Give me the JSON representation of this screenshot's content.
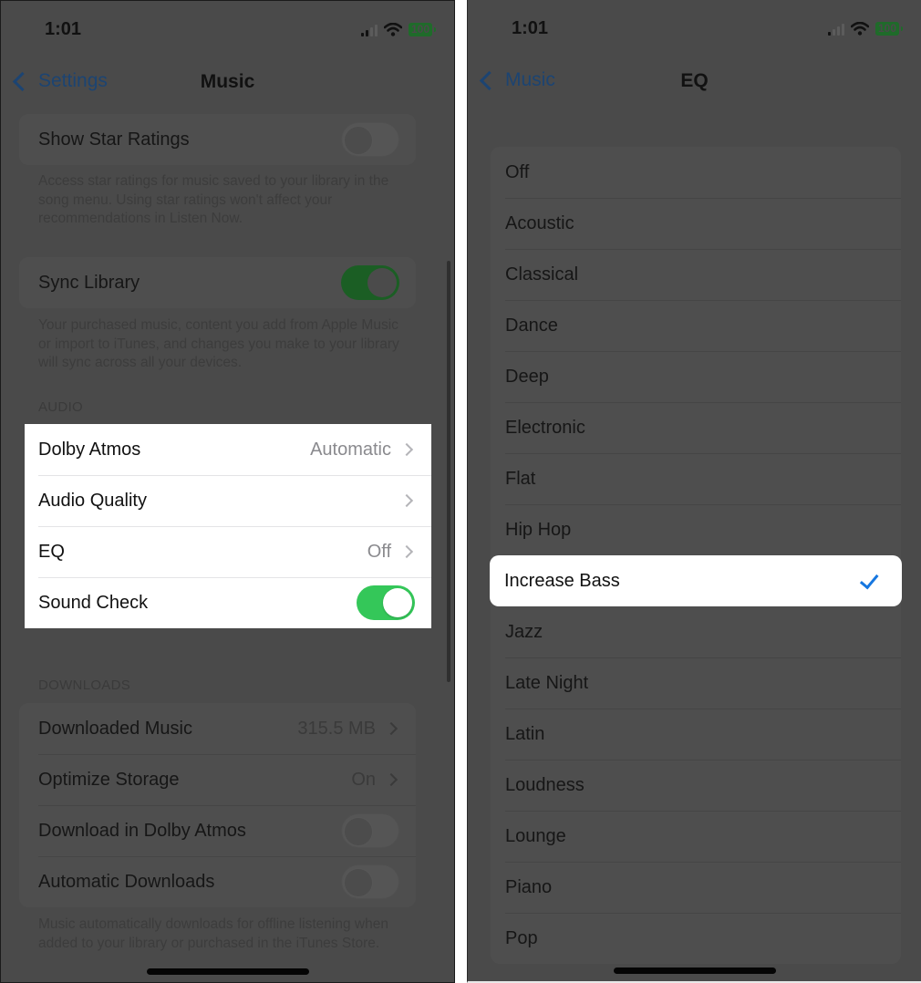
{
  "left_screen": {
    "status_bar": {
      "time": "1:01",
      "battery": "100",
      "icons": [
        "cellular-signal-icon",
        "wifi-icon",
        "battery-icon"
      ]
    },
    "nav": {
      "back_label": "Settings",
      "title": "Music"
    },
    "library_group_1": {
      "rows": [
        {
          "label": "Show Star Ratings",
          "toggle": "off"
        }
      ],
      "footer": "Access star ratings for music saved to your library in the song menu. Using star ratings won't affect your recommendations in Listen Now."
    },
    "library_group_2": {
      "rows": [
        {
          "label": "Sync Library",
          "toggle": "on"
        }
      ],
      "footer": "Your purchased music, content you add from Apple Music or import to iTunes, and changes you make to your library will sync across all your devices."
    },
    "audio": {
      "header": "AUDIO",
      "rows": [
        {
          "label": "Dolby Atmos",
          "value": "Automatic"
        },
        {
          "label": "Audio Quality",
          "value": ""
        },
        {
          "label": "EQ",
          "value": "Off"
        },
        {
          "label": "Sound Check",
          "toggle": "on"
        }
      ]
    },
    "downloads": {
      "header": "DOWNLOADS",
      "rows": [
        {
          "label": "Downloaded Music",
          "value": "315.5 MB"
        },
        {
          "label": "Optimize Storage",
          "value": "On"
        },
        {
          "label": "Download in Dolby Atmos",
          "toggle": "off"
        },
        {
          "label": "Automatic Downloads",
          "toggle": "off"
        }
      ],
      "footer": "Music automatically downloads for offline listening when added to your library or purchased in the iTunes Store."
    }
  },
  "right_screen": {
    "status_bar": {
      "time": "1:01",
      "battery": "100"
    },
    "nav": {
      "back_label": "Music",
      "title": "EQ"
    },
    "eq_options": [
      "Off",
      "Acoustic",
      "Classical",
      "Dance",
      "Deep",
      "Electronic",
      "Flat",
      "Hip Hop",
      "Increase Bass",
      "Jazz",
      "Late Night",
      "Latin",
      "Loudness",
      "Lounge",
      "Piano",
      "Pop"
    ],
    "selected": "Increase Bass"
  },
  "colors": {
    "accent_blue": "#1677e0",
    "toggle_green": "#34c759",
    "dim_overlay": "#4a4a4a"
  }
}
